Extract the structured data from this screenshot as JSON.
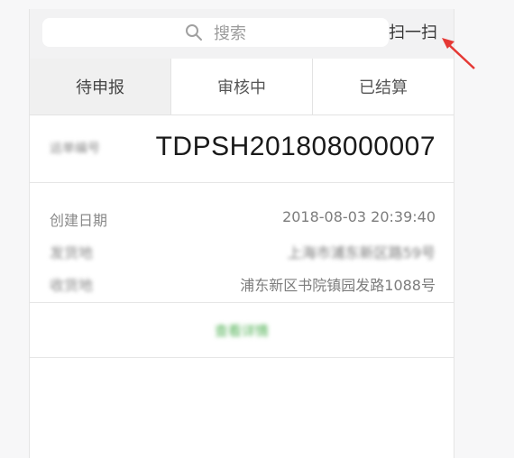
{
  "search": {
    "placeholder": "搜索"
  },
  "scan_label": "扫一扫",
  "tabs": [
    {
      "label": "待申报",
      "active": true
    },
    {
      "label": "审核中",
      "active": false
    },
    {
      "label": "已结算",
      "active": false
    }
  ],
  "record": {
    "id_label": "运单编号",
    "id_value": "TDPSH201808000007",
    "details": [
      {
        "label": "创建日期",
        "value": "2018-08-03 20:39:40"
      },
      {
        "label": "发货地",
        "value": "上海市浦东新区路59号"
      },
      {
        "label": "收货地",
        "value": "浦东新区书院镇园发路1088号"
      }
    ],
    "action_label": "查看详情"
  },
  "colors": {
    "accent_green": "#4caf50",
    "arrow_red": "#e53935"
  }
}
